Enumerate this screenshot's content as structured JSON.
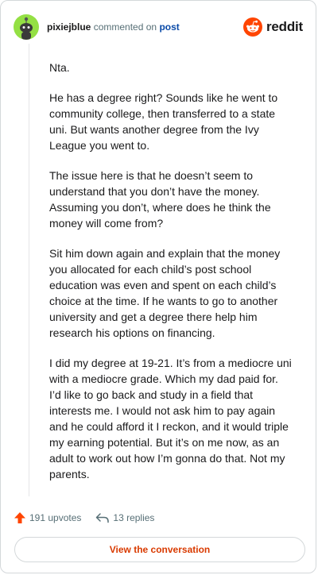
{
  "comment": {
    "username": "pixiejblue",
    "action_text": "commented on",
    "post_link": "post",
    "paragraphs": [
      "Nta.",
      "He has a degree right? Sounds like he went to community college, then transferred to a state uni. But wants another degree from the Ivy League you went to.",
      "The issue here is that he doesn’t seem to understand that you don’t have the money. Assuming you don’t, where does he think the money will come from?",
      "Sit him down again and explain that the money you allocated for each child’s post school education was even and spent on each child’s choice at the time. If he wants to go to another university and get a degree there help him research his options on financing.",
      "I did my degree at 19-21. It’s from a mediocre uni with a mediocre grade. Which my dad paid for. I’d like to go back and study in a field that interests me. I would not ask him to pay again and he could afford it I reckon, and it would triple my earning potential. But it’s on me now, as an adult to work out how I’m gonna do that. Not my parents."
    ]
  },
  "brand": {
    "name": "reddit",
    "icon": "reddit-logo-icon",
    "color": "#ff4500"
  },
  "actions": {
    "upvotes": "191 upvotes",
    "replies": "13 replies"
  },
  "view_button": "View the conversation",
  "colors": {
    "accent": "#d93a00",
    "upvote": "#ff4500",
    "avatar": "#94e044"
  }
}
